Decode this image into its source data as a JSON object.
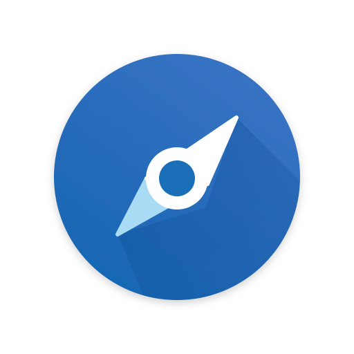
{
  "app_icon": {
    "name": "compass-app-icon",
    "colors": {
      "background": "#ffffff",
      "circle_top": "#3a73c4",
      "circle_bottom": "#1766b3",
      "long_shadow": "#0f4f96",
      "needle_north": "#ffffff",
      "needle_south": "#a9dcf4",
      "hub_center": "#1a6fb8"
    }
  }
}
